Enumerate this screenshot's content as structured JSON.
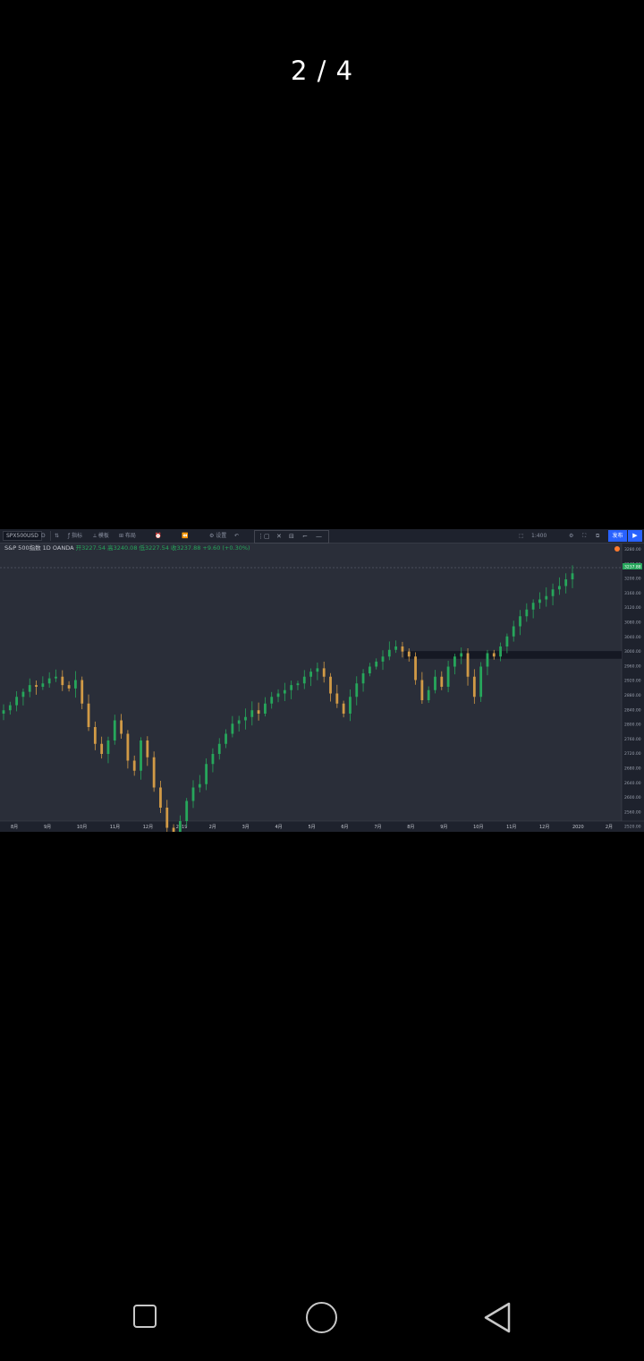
{
  "viewer": {
    "page_counter": "2 / 4"
  },
  "toolbar": {
    "symbol": "SPX500USD",
    "interval": "D",
    "items": [
      "ƒ 指标",
      "⟂ 模板",
      "⊞ 布局",
      "↶",
      "⚙ 设置"
    ],
    "zoom": "1:400",
    "publish": "发布",
    "colors": {
      "bg": "#1e222d",
      "accent": "#2962ff"
    }
  },
  "legend": {
    "name": "S&P 500指数",
    "interval": "1D",
    "source": "OANDA",
    "ohlc": "开3227.54 高3240.08 低3227.54 收3237.88 +9.60 (+0.30%)"
  },
  "chart_data": {
    "type": "candlestick",
    "series_colors": {
      "up": "#26a65b",
      "down": "#d19a46"
    },
    "y_ticks": [
      "3280.00",
      "3240.00",
      "3200.00",
      "3160.00",
      "3120.00",
      "3080.00",
      "3040.00",
      "3000.00",
      "2960.00",
      "2920.00",
      "2880.00",
      "2840.00",
      "2800.00",
      "2760.00",
      "2720.00",
      "2680.00",
      "2640.00",
      "2600.00",
      "2560.00",
      "2520.00"
    ],
    "last_price": "3237.88",
    "x_ticks": [
      "8月",
      "9月",
      "10月",
      "11月",
      "12月",
      "2019",
      "2月",
      "3月",
      "4月",
      "5月",
      "6月",
      "7月",
      "8月",
      "9月",
      "10月",
      "11月",
      "12月",
      "2020",
      "2月"
    ],
    "closes": [
      2830,
      2845,
      2870,
      2885,
      2905,
      2900,
      2910,
      2925,
      2930,
      2905,
      2895,
      2920,
      2850,
      2780,
      2730,
      2700,
      2740,
      2800,
      2760,
      2680,
      2650,
      2740,
      2690,
      2600,
      2540,
      2480,
      2430,
      2500,
      2560,
      2600,
      2610,
      2670,
      2700,
      2730,
      2760,
      2790,
      2800,
      2810,
      2830,
      2820,
      2850,
      2870,
      2880,
      2890,
      2905,
      2910,
      2930,
      2945,
      2955,
      2930,
      2880,
      2850,
      2820,
      2870,
      2910,
      2940,
      2960,
      2975,
      2990,
      3010,
      3020,
      3005,
      2990,
      2920,
      2860,
      2890,
      2930,
      2900,
      2960,
      2990,
      3000,
      2930,
      2870,
      2960,
      3000,
      2990,
      3020,
      3050,
      3080,
      3110,
      3130,
      3150,
      3160,
      3170,
      3190,
      3200,
      3220,
      3237.88
    ],
    "resistance_zone": [
      2990,
      3005
    ]
  }
}
